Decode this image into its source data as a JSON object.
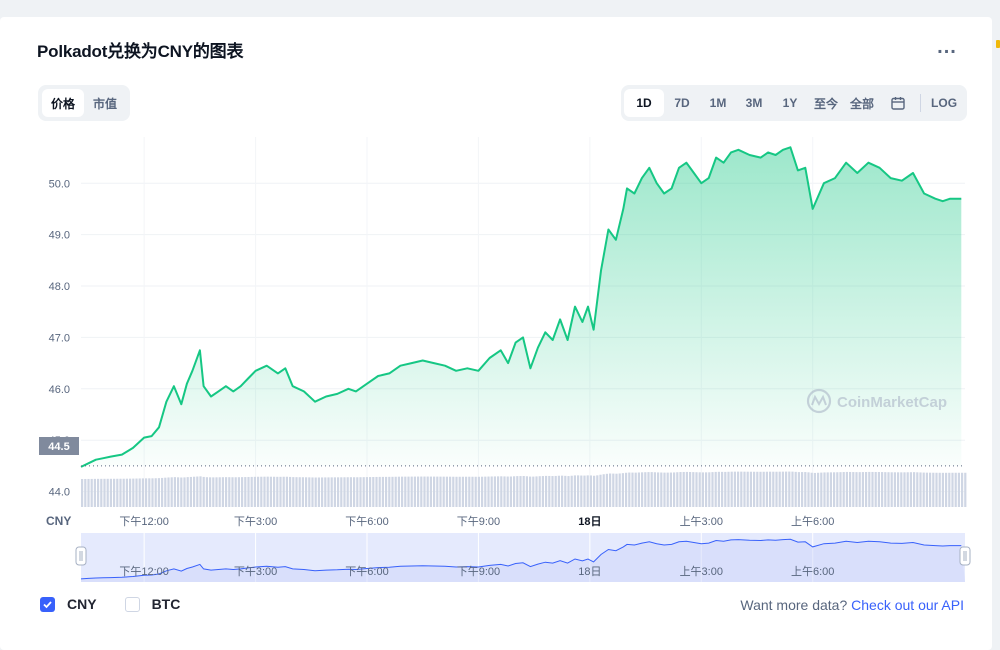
{
  "title": "Polkadot兑换为CNY的图表",
  "more_label": "...",
  "metric_tabs": [
    {
      "label": "价格",
      "active": true
    },
    {
      "label": "市值",
      "active": false
    }
  ],
  "range_tabs": [
    {
      "label": "1D",
      "active": true
    },
    {
      "label": "7D",
      "active": false
    },
    {
      "label": "1M",
      "active": false
    },
    {
      "label": "3M",
      "active": false
    },
    {
      "label": "1Y",
      "active": false
    },
    {
      "label": "至今",
      "active": false
    },
    {
      "label": "全部",
      "active": false
    }
  ],
  "calendar_icon": "calendar-icon",
  "log_label": "LOG",
  "legend": [
    {
      "label": "CNY",
      "checked": true
    },
    {
      "label": "BTC",
      "checked": false
    }
  ],
  "api_prompt": "Want more data?",
  "api_link": "Check out our API",
  "watermark": "CoinMarketCap",
  "colors": {
    "line": "#16c784",
    "accent": "#3861fb",
    "volume": "#cfd6e4",
    "nav_fill": "#e5eafd"
  },
  "chart_data": {
    "type": "area",
    "currency_label": "CNY",
    "ylim": [
      43.7,
      50.9
    ],
    "yticks": [
      44.0,
      45.0,
      46.0,
      47.0,
      48.0,
      49.0,
      50.0
    ],
    "ytick_labels": [
      "44.0",
      "45.0",
      "46.0",
      "47.0",
      "48.0",
      "49.0",
      "50.0"
    ],
    "open_price": 44.5,
    "open_price_label": "44.5",
    "xlim": [
      10.3,
      34.1
    ],
    "xticks": [
      12,
      15,
      18,
      21,
      24,
      27,
      30
    ],
    "xtick_labels": [
      "下午12:00",
      "下午3:00",
      "下午6:00",
      "下午9:00",
      "18日",
      "上午3:00",
      "上午6:00"
    ],
    "x": [
      10.3,
      10.5,
      10.7,
      10.9,
      11.1,
      11.4,
      11.7,
      12.0,
      12.2,
      12.4,
      12.6,
      12.8,
      13.0,
      13.15,
      13.3,
      13.5,
      13.6,
      13.8,
      14.0,
      14.2,
      14.4,
      14.6,
      14.8,
      15.0,
      15.3,
      15.6,
      15.8,
      16.0,
      16.3,
      16.6,
      16.9,
      17.2,
      17.5,
      17.7,
      18.0,
      18.3,
      18.6,
      18.9,
      19.2,
      19.5,
      19.8,
      20.1,
      20.4,
      20.7,
      21.0,
      21.3,
      21.6,
      21.8,
      22.0,
      22.2,
      22.4,
      22.6,
      22.8,
      23.0,
      23.2,
      23.4,
      23.6,
      23.8,
      23.95,
      24.1,
      24.3,
      24.5,
      24.7,
      24.9,
      25.0,
      25.2,
      25.4,
      25.6,
      25.8,
      26.0,
      26.2,
      26.4,
      26.6,
      26.8,
      27.0,
      27.2,
      27.4,
      27.6,
      27.8,
      28.0,
      28.3,
      28.6,
      28.8,
      29.0,
      29.2,
      29.4,
      29.6,
      29.8,
      30.0,
      30.3,
      30.6,
      30.9,
      31.2,
      31.5,
      31.8,
      32.1,
      32.4,
      32.7,
      33.0,
      33.3,
      33.5,
      33.7,
      34.0
    ],
    "y": [
      44.48,
      44.55,
      44.62,
      44.65,
      44.68,
      44.72,
      44.85,
      45.05,
      45.08,
      45.25,
      45.75,
      46.05,
      45.7,
      46.1,
      46.35,
      46.75,
      46.05,
      45.85,
      45.95,
      46.05,
      45.95,
      46.05,
      46.2,
      46.35,
      46.45,
      46.3,
      46.4,
      46.05,
      45.95,
      45.75,
      45.85,
      45.9,
      46.0,
      45.95,
      46.1,
      46.25,
      46.3,
      46.45,
      46.5,
      46.55,
      46.5,
      46.45,
      46.35,
      46.4,
      46.35,
      46.6,
      46.75,
      46.5,
      46.9,
      47.0,
      46.4,
      46.8,
      47.1,
      46.95,
      47.35,
      46.95,
      47.6,
      47.3,
      47.6,
      47.15,
      48.3,
      49.1,
      48.9,
      49.5,
      49.9,
      49.8,
      50.1,
      50.3,
      50.0,
      49.8,
      49.9,
      50.3,
      50.4,
      50.2,
      50.0,
      50.1,
      50.5,
      50.4,
      50.6,
      50.65,
      50.55,
      50.5,
      50.6,
      50.55,
      50.65,
      50.7,
      50.25,
      50.3,
      49.5,
      50.0,
      50.1,
      50.4,
      50.2,
      50.4,
      50.3,
      50.1,
      50.05,
      50.2,
      49.8,
      49.7,
      49.65,
      49.7,
      49.7
    ],
    "nav_xtick_labels": [
      "下午12:00",
      "下午3:00",
      "下午6:00",
      "下午9:00",
      "18日",
      "上午3:00",
      "上午6:00"
    ]
  }
}
